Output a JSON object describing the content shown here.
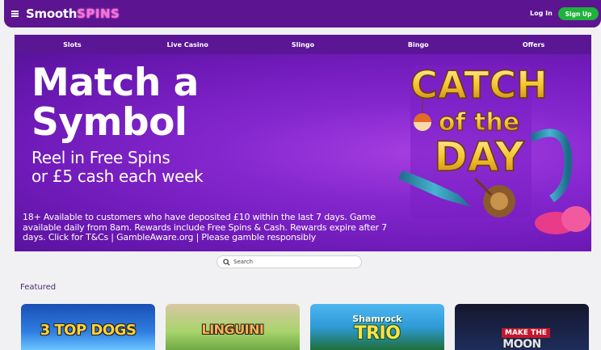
{
  "header": {
    "logo_main": "Smooth",
    "logo_accent": "SPINS",
    "login_label": "Log In",
    "signup_label": "Sign Up"
  },
  "nav": {
    "items": [
      "Slots",
      "Live Casino",
      "Slingo",
      "Bingo",
      "Offers"
    ]
  },
  "banner": {
    "headline_1": "Match a",
    "headline_2": "Symbol",
    "sub_1": "Reel in Free Spins",
    "sub_2": "or £5 cash each week",
    "terms_1": "18+ Available to customers who have deposited £10 within the last 7 days. Game",
    "terms_2": "available daily from 8am. Rewards include Free Spins & Cash. Rewards expire after 7",
    "terms_3": "days. Click for T&Cs | GambleAware.org | Please gamble responsibly",
    "promo_art_1": "CATCH",
    "promo_art_2": "of the",
    "promo_art_3": "DAY"
  },
  "search": {
    "placeholder": "Search"
  },
  "featured": {
    "title": "Featured",
    "games": [
      {
        "title": "3 TOP DOGS"
      },
      {
        "title": "LINGUINI"
      },
      {
        "brand": "Shamrock",
        "title": "TRIO"
      },
      {
        "brand": "MAKE THE",
        "title": "MOON"
      }
    ]
  },
  "colors": {
    "header_bg": "#5c1491",
    "nav_bg": "#5b1696",
    "banner_bg": "#8527cf",
    "signup_bg": "#1eb33a",
    "logo_accent": "#ff6fd8"
  }
}
